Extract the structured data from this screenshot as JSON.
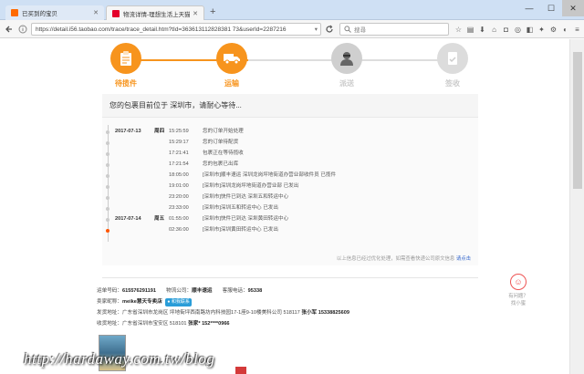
{
  "browser": {
    "tabs": [
      {
        "label": "已买到的宝贝",
        "active": false,
        "favicon_color": "#ff6a00"
      },
      {
        "label": "物流详情-理想生活上天猫",
        "active": true,
        "favicon_color": "#e4002b"
      }
    ],
    "new_tab": "+",
    "url": "https://detail.i56.taobao.com/trace/trace_detail.htm?tId=363613112828381 73&userId=2287216",
    "search_placeholder": "搜尋",
    "window_controls": [
      "—",
      "☐",
      "✕"
    ]
  },
  "steps": [
    {
      "label": "待揽件",
      "state": "done",
      "icon": "clipboard-icon",
      "color": "#f7941d"
    },
    {
      "label": "运输",
      "state": "current",
      "icon": "truck-icon",
      "color": "#f7941d"
    },
    {
      "label": "派送",
      "state": "pending",
      "icon": "courier-icon",
      "color": "#cccccc"
    },
    {
      "label": "签收",
      "state": "pending",
      "icon": "signed-doc-icon",
      "color": "#cccccc"
    }
  ],
  "status_message": "您的包裹目前位于 深圳市，请耐心等待...",
  "timeline": [
    {
      "date": "2017-07-13",
      "weekday": "周四",
      "time": "15:25:59",
      "desc": "您的订单开始处理"
    },
    {
      "date": "",
      "weekday": "",
      "time": "15:29:17",
      "desc": "您的订单待配货"
    },
    {
      "date": "",
      "weekday": "",
      "time": "17:21:41",
      "desc": "包裹正在等待揽收"
    },
    {
      "date": "",
      "weekday": "",
      "time": "17:21:54",
      "desc": "您的包裹已出库"
    },
    {
      "date": "",
      "weekday": "",
      "time": "18:05:00",
      "desc": "[深圳市]顺丰速运 深圳龙岗坪地街道办营业部收件员 已揽件"
    },
    {
      "date": "",
      "weekday": "",
      "time": "19:01:00",
      "desc": "[深圳市]深圳龙岗坪地街道办营业部 已发出"
    },
    {
      "date": "",
      "weekday": "",
      "time": "23:20:00",
      "desc": "[深圳市]快件已到达 深圳五和转运中心"
    },
    {
      "date": "",
      "weekday": "",
      "time": "23:33:00",
      "desc": "[深圳市]深圳五和转运中心 已发出"
    },
    {
      "date": "2017-07-14",
      "weekday": "周五",
      "time": "01:55:00",
      "desc": "[深圳市]快件已到达 深圳黄田转运中心"
    },
    {
      "date": "",
      "weekday": "",
      "time": "02:36:00",
      "desc": "[深圳市]深圳黄田转运中心 已发出"
    }
  ],
  "timeline_footer": {
    "text": "以上信息已经过优化处理，如需查看快递公司原文信息",
    "link": "请点击"
  },
  "order_info": {
    "waybill_label": "运单号码：",
    "waybill_no": "615576291191",
    "carrier_label": "物流公司：",
    "carrier": "顺丰速运",
    "phone_label": "客服电话：",
    "phone": "95338",
    "seller_label": "卖家昵称：",
    "seller": "meike慧天专卖店",
    "contact_badge": "和我联系",
    "ship_from_label": "发货地址：",
    "ship_from": "广东省深圳市龙岗区 坪地街坪西南路坊内科技园17-1座9-10楼美科公司 518117",
    "ship_contact": "张小军",
    "ship_phone": "15338825609",
    "ship_to_label": "收货地址：",
    "ship_to": "广东省深圳市宝安区 518101",
    "recipient": "张家*",
    "recipient_phone": "152****0966"
  },
  "help": {
    "line1": "有问题？",
    "line2": "找小蜜"
  },
  "watermark": "http://hardaway.com.tw/blog"
}
